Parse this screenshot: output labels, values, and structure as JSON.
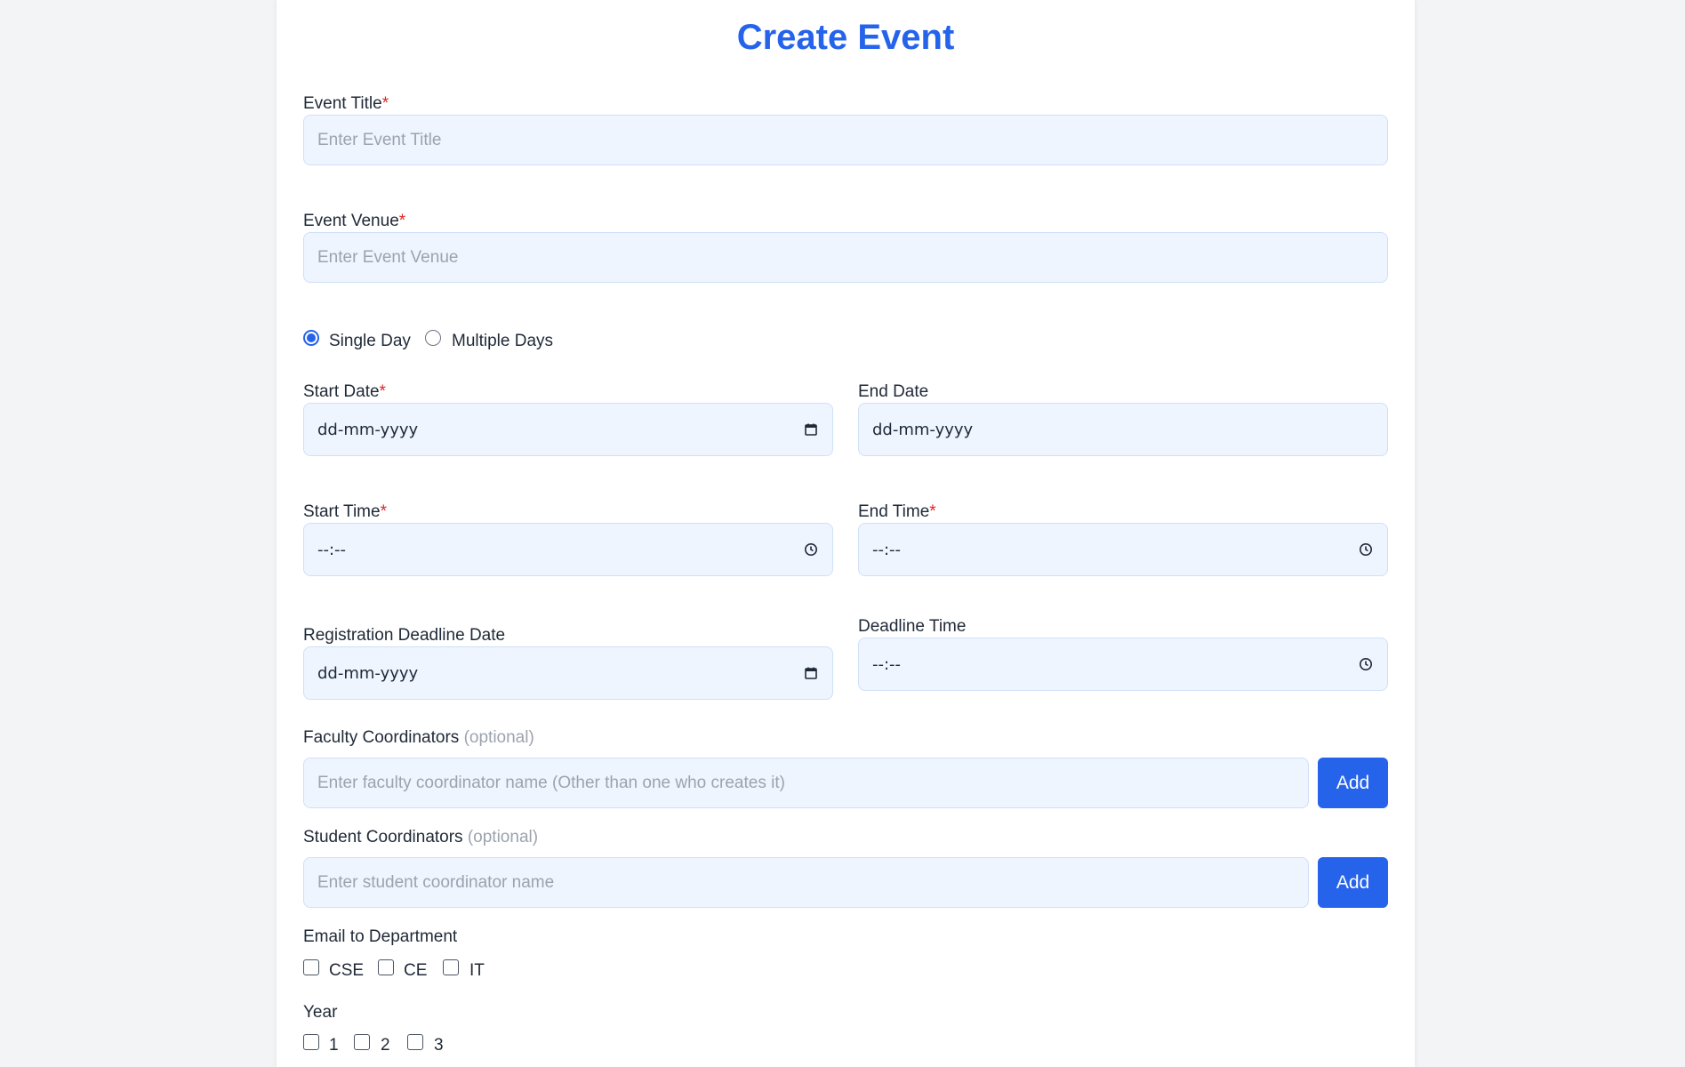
{
  "page_title": "Create Event",
  "event_title": {
    "label": "Event Title",
    "required": "*",
    "placeholder": "Enter Event Title"
  },
  "event_venue": {
    "label": "Event Venue",
    "required": "*",
    "placeholder": "Enter Event Venue"
  },
  "duration": {
    "options": [
      "Single Day",
      "Multiple Days"
    ],
    "selected": "Single Day"
  },
  "start_date": {
    "label": "Start Date",
    "required": "*",
    "value": "dd-mm-yyyy"
  },
  "end_date": {
    "label": "End Date",
    "value": "dd-mm-yyyy"
  },
  "start_time": {
    "label": "Start Time",
    "required": "*",
    "value": "--:--"
  },
  "end_time": {
    "label": "End Time",
    "required": "*",
    "value": "--:--"
  },
  "deadline_date": {
    "label": "Registration Deadline Date",
    "value": "dd-mm-yyyy"
  },
  "deadline_time": {
    "label": "Deadline Time",
    "value": "--:--"
  },
  "faculty": {
    "label": "Faculty Coordinators",
    "optional": "(optional)",
    "placeholder": "Enter faculty coordinator name (Other than one who creates it)",
    "button": "Add"
  },
  "student": {
    "label": "Student Coordinators",
    "optional": "(optional)",
    "placeholder": "Enter student coordinator name",
    "button": "Add"
  },
  "departments": {
    "label": "Email to Department",
    "options": [
      "CSE",
      "CE",
      "IT"
    ]
  },
  "year": {
    "label": "Year",
    "options": [
      "1",
      "2",
      "3"
    ]
  },
  "colors": {
    "accent": "#2563eb",
    "required": "#dc2626",
    "input_bg": "#eef5ff",
    "page_bg": "#f3f4f6"
  },
  "icons": {
    "date": "calendar-icon",
    "time": "clock-icon"
  }
}
